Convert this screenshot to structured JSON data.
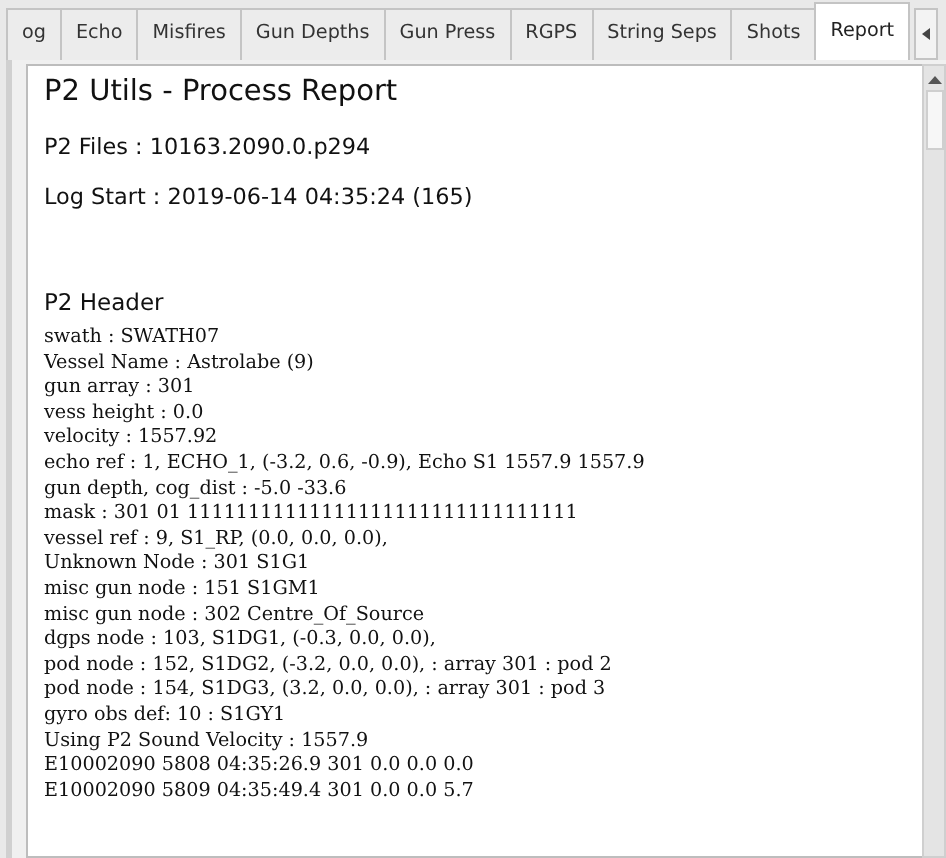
{
  "tabs": [
    {
      "label": "og",
      "selected": false
    },
    {
      "label": "Echo",
      "selected": false
    },
    {
      "label": "Misfires",
      "selected": false
    },
    {
      "label": "Gun Depths",
      "selected": false
    },
    {
      "label": "Gun Press",
      "selected": false
    },
    {
      "label": "RGPS",
      "selected": false
    },
    {
      "label": "String Seps",
      "selected": false
    },
    {
      "label": "Shots",
      "selected": false
    },
    {
      "label": "Report",
      "selected": true
    }
  ],
  "report": {
    "title": "P2 Utils - Process Report",
    "files": "P2 Files : 10163.2090.0.p294",
    "log_start": "Log Start : 2019-06-14 04:35:24 (165)",
    "section_heading": "P2 Header",
    "lines": [
      "swath : SWATH07",
      "Vessel Name : Astrolabe (9)",
      "gun array : 301",
      "vess height : 0.0",
      "velocity : 1557.92",
      "echo ref : 1, ECHO_1, (-3.2, 0.6, -0.9), Echo S1 1557.9 1557.9",
      "gun depth, cog_dist : -5.0 -33.6",
      "mask : 301 01 11111111111111111111111111111111",
      "vessel ref : 9, S1_RP, (0.0, 0.0, 0.0),",
      "Unknown Node : 301 S1G1",
      "misc gun node : 151 S1GM1",
      "misc gun node : 302 Centre_Of_Source",
      "dgps node : 103, S1DG1, (-0.3, 0.0, 0.0),",
      "pod node : 152, S1DG2, (-3.2, 0.0, 0.0), : array 301 : pod 2",
      "pod node : 154, S1DG3, (3.2, 0.0, 0.0), : array 301 : pod 3",
      "gyro obs def: 10 : S1GY1",
      "Using P2 Sound Velocity : 1557.9",
      "E10002090 5808 04:35:26.9 301 0.0 0.0 0.0",
      "E10002090 5809 04:35:49.4 301 0.0 0.0 5.7"
    ]
  }
}
